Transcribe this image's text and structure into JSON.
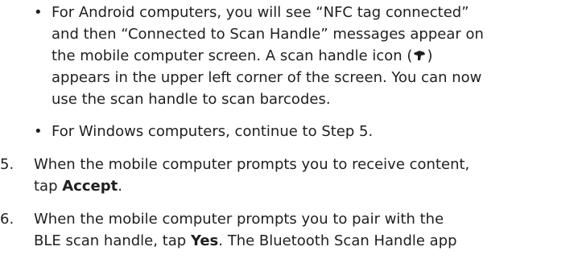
{
  "bullets": [
    {
      "marker": "•",
      "lines": [
        "For Android computers, you will see “NFC tag connected”",
        "and then “Connected to Scan Handle” messages appear on",
        "the mobile computer screen. A scan handle icon (",
        "appears in the upper left corner of the screen. You can now",
        "use the scan handle to scan barcodes."
      ],
      "icon_close": ")",
      "icon_name": "scan-handle-icon"
    },
    {
      "marker": "•",
      "lines": [
        "For Windows computers, continue to Step 5."
      ]
    }
  ],
  "steps": [
    {
      "number": "5.",
      "line1": "When the mobile computer prompts you to receive content,",
      "line2_prefix": "tap ",
      "line2_bold": "Accept",
      "line2_suffix": "."
    },
    {
      "number": "6.",
      "line1": "When the mobile computer prompts you to pair with the",
      "line2_prefix": "BLE scan handle, tap ",
      "line2_bold": "Yes",
      "line2_suffix": ". The Bluetooth Scan Handle app"
    }
  ]
}
